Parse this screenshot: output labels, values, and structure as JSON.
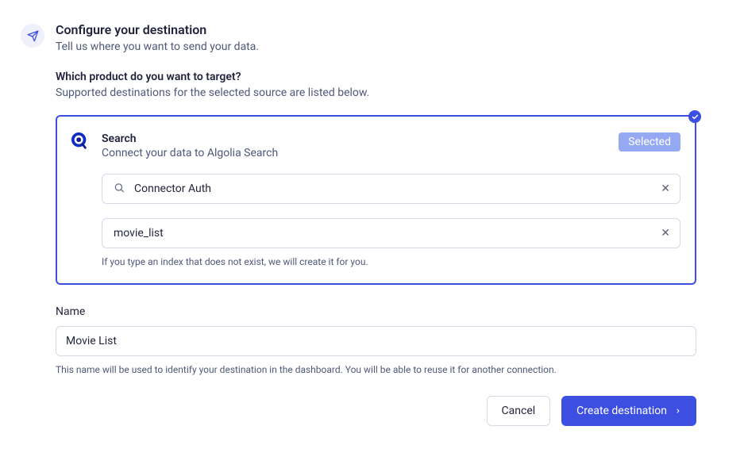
{
  "header": {
    "title": "Configure your destination",
    "subtitle": "Tell us where you want to send your data."
  },
  "productSection": {
    "title": "Which product do you want to target?",
    "subtitle": "Supported destinations for the selected source are listed below."
  },
  "card": {
    "title": "Search",
    "description": "Connect your data to Algolia Search",
    "badge": "Selected",
    "authInput": {
      "value": "Connector Auth"
    },
    "indexInput": {
      "value": "movie_list"
    },
    "hint": "If you type an index that does not exist, we will create it for you."
  },
  "nameSection": {
    "label": "Name",
    "value": "Movie List",
    "hint": "This name will be used to identify your destination in the dashboard. You will be able to reuse it for another connection."
  },
  "footer": {
    "cancel": "Cancel",
    "submit": "Create destination"
  }
}
